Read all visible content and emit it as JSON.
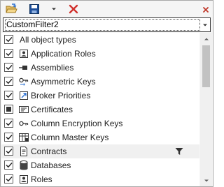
{
  "toolbar": {
    "open_icon": "open-folder-icon",
    "save_icon": "save-icon",
    "save_dropdown_icon": "chevron-down-icon",
    "delete_icon": "delete-icon",
    "close_icon": "close-icon"
  },
  "filter_selector": {
    "value": "CustomFilter2"
  },
  "list": {
    "items": [
      {
        "label": "All object types",
        "checked": true,
        "icon": "none"
      },
      {
        "label": "Application Roles",
        "checked": true,
        "icon": "application-role-icon"
      },
      {
        "label": "Assemblies",
        "checked": true,
        "icon": "assembly-icon"
      },
      {
        "label": "Asymmetric Keys",
        "checked": true,
        "icon": "asymmetric-key-icon"
      },
      {
        "label": "Broker Priorities",
        "checked": true,
        "icon": "broker-priority-icon"
      },
      {
        "label": "Certificates",
        "checked": "partial",
        "icon": "certificate-icon"
      },
      {
        "label": "Column Encryption Keys",
        "checked": true,
        "icon": "column-encryption-key-icon"
      },
      {
        "label": "Column Master Keys",
        "checked": true,
        "icon": "column-master-key-icon"
      },
      {
        "label": "Contracts",
        "checked": true,
        "icon": "contract-icon",
        "hovered": true,
        "filter_icon": "filter-funnel-icon"
      },
      {
        "label": "Databases",
        "checked": true,
        "icon": "database-icon"
      },
      {
        "label": "Roles",
        "checked": true,
        "icon": "role-icon"
      }
    ]
  },
  "colors": {
    "delete_red": "#d0312d",
    "save_blue": "#1f4f9a",
    "hover_row": "#f0f0f0"
  }
}
